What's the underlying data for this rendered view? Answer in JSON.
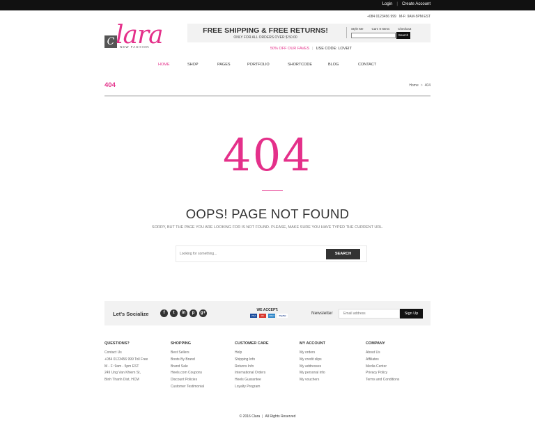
{
  "topbar": {
    "login": "Login",
    "separator": "|",
    "create_account": "Create Account"
  },
  "header": {
    "phone": "+084 0123456 999",
    "hours": "M-F: 9AM-5PM EST",
    "logo": {
      "mark": "C",
      "brand": "lara",
      "tagline": "NEW FASHION"
    },
    "promo": {
      "headline": "FREE SHIPPING & FREE RETURNS!",
      "subline": "ONLY FOR ALL ORDERS OVER $ 50.00"
    },
    "account": {
      "style_me": "Style Me",
      "cart": "Cart: 0 Items",
      "checkout": "Checkout"
    },
    "search_button": "Search",
    "sale": "50% OFF OUR FAVES",
    "sale_separator": "|",
    "code": "USE CODE: LOVEIT"
  },
  "nav": {
    "items": [
      {
        "label": "HOME",
        "active": true
      },
      {
        "label": "SHOP",
        "active": false
      },
      {
        "label": "PAGES",
        "active": false
      },
      {
        "label": "PORTFOLIO",
        "active": false
      },
      {
        "label": "SHORTCODE",
        "active": false
      },
      {
        "label": "BLOG",
        "active": false
      },
      {
        "label": "CONTACT",
        "active": false
      }
    ]
  },
  "page": {
    "code": "404",
    "breadcrumb": {
      "home": "Home",
      "separator": ">",
      "current": "404"
    },
    "big": "404",
    "title": "OOPS! PAGE NOT FOUND",
    "message": "SORRY, BUT THE PAGE YOU ARE LOOKING FOR IS NOT FOUND. PLEASE, MAKE SURE YOU HAVE TYPED THE CURRENT URL.",
    "search_placeholder": "Looking for something...",
    "search_button": "SEARCH"
  },
  "social": {
    "label": "Let's Socialize",
    "icons": [
      "f",
      "t",
      "in",
      "p",
      "g+"
    ],
    "accept_label": "WE ACCEPT:",
    "cards": [
      "VISA",
      "MC",
      "AMEX",
      "PayPal"
    ],
    "newsletter_label": "Newsletter",
    "email_placeholder": "Email address",
    "signup": "Sign Up"
  },
  "footer": {
    "questions": {
      "title": "QUESTIONS?",
      "lines": [
        "Contact Us",
        "+084 0123456 999 Toll Free",
        "M - F: 9am - 5pm EST",
        "249 Ung Van Khiem St,",
        "Binh Thanh Dist, HCM"
      ]
    },
    "shopping": {
      "title": "SHOPPING",
      "lines": [
        "Best Sellers",
        "Boots By Brand",
        "Brand Sale",
        "Heels.com Coupons",
        "Discount Policies",
        "Customer Testimonial"
      ]
    },
    "customer_care": {
      "title": "CUSTOMER CARE",
      "lines": [
        "Help",
        "Shipping Info",
        "Returns Info",
        "International Orders",
        "Heels Guarantee",
        "Loyalty Program"
      ]
    },
    "my_account": {
      "title": "MY ACCOUNT",
      "lines": [
        "My orders",
        "My credit slips",
        "My addresses",
        "My personal info",
        "My vouchers"
      ]
    },
    "company": {
      "title": "COMPANY",
      "lines": [
        "About Us",
        "Affiliates",
        "Media Center",
        "Privacy Policy",
        "Terms and Conditions"
      ]
    },
    "copyright": "© 2016 Clara",
    "copyright_separator": "|",
    "rights": "All Rights Reserved"
  },
  "colors": {
    "accent": "#e4308a",
    "dark": "#111111",
    "panel": "#f2f2f2"
  }
}
